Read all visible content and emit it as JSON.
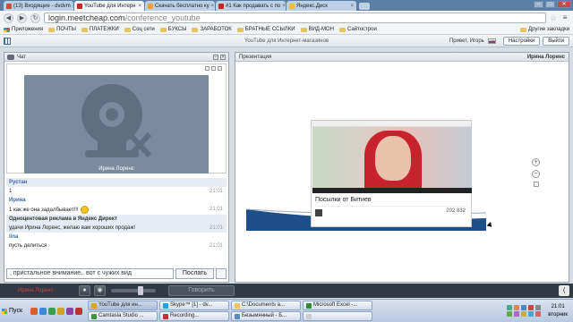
{
  "browser": {
    "tabs": [
      {
        "label": "(13) Входящие - dvdvm",
        "color": "#d64a3b",
        "active": false
      },
      {
        "label": "YouTube для Интерн",
        "color": "#cc2222",
        "active": true
      },
      {
        "label": "Скачать бесплатно ку",
        "color": "#f0a030",
        "active": false
      },
      {
        "label": "#1 Как продавать с по",
        "color": "#cc2222",
        "active": false
      },
      {
        "label": "Яндекс.Диск",
        "color": "#f0c030",
        "active": false
      }
    ],
    "url_host": "login.meetcheap.com",
    "url_path": "/conference_youtube",
    "bookmarks": [
      "Приложения",
      "ПОЧТЫ",
      "ПЛАТЕЖКИ",
      "Соц сети",
      "БУКСЫ",
      "ЗАРАБОТОК",
      "БРАТНЫЕ ССЫЛКИ",
      "ВИД-МОН",
      "Сайтострои"
    ],
    "other_bookmarks": "Другие закладки"
  },
  "app": {
    "title": "YouTube для Интернет-магазинов",
    "greeting": "Привет, Игорь",
    "settings_label": "Настройки",
    "logout_label": "Выйти"
  },
  "chat": {
    "header": "Чат",
    "cam_name": "Ирина Лоренс",
    "messages": [
      {
        "name": "Рустан",
        "text": "",
        "time": "",
        "highlight": true
      },
      {
        "name": "",
        "text": "1",
        "time": "21:01",
        "highlight": false
      },
      {
        "name": "Ирина",
        "text": "",
        "time": "",
        "highlight": false
      },
      {
        "name": "",
        "text": "1 как же она задалбывает!!!",
        "time": "21:01",
        "highlight": false,
        "smile": true
      },
      {
        "name": "Одноцентовая реклама в Яндекс Директ",
        "text": "",
        "time": "",
        "highlight": true
      },
      {
        "name": "",
        "text": "удачи Ирина Лоренс, желаю вам хороших продаж!",
        "time": "21:01",
        "highlight": true
      },
      {
        "name": "lina",
        "text": "",
        "time": "",
        "highlight": false
      },
      {
        "name": "",
        "text": "пусть делиться",
        "time": "21:01",
        "highlight": false
      }
    ],
    "input_value": ", пристальное внимание.. вот с чужих вид",
    "send_label": "Послать"
  },
  "presentation": {
    "header": "Презентация",
    "presenter": "Ирина Лоренс",
    "video_title": "Посылки от Битиев",
    "views": "202 832"
  },
  "controls": {
    "self_name": "Ирина Лоренс",
    "talk_label": "Говорить"
  },
  "taskbar": {
    "start_label": "Пуск",
    "tasks": [
      {
        "label": "YouTube для ин...",
        "color": "#e0a020",
        "active": true
      },
      {
        "label": "Skype™ [1] - dv...",
        "color": "#1da1e0",
        "active": false
      },
      {
        "label": "C:\\Documents a...",
        "color": "#e8c45a",
        "active": false
      },
      {
        "label": "Microsoft Excel -...",
        "color": "#2a8a3a",
        "active": false
      },
      {
        "label": "Camtasia Studio ...",
        "color": "#3a9a3a",
        "active": false
      },
      {
        "label": "Recording...",
        "color": "#c03030",
        "active": false
      },
      {
        "label": "Безымянный - Б...",
        "color": "#5a8ac0",
        "active": false
      },
      {
        "label": "",
        "color": "#ccc",
        "active": false
      }
    ],
    "time": "21:01",
    "day": "вторник"
  }
}
